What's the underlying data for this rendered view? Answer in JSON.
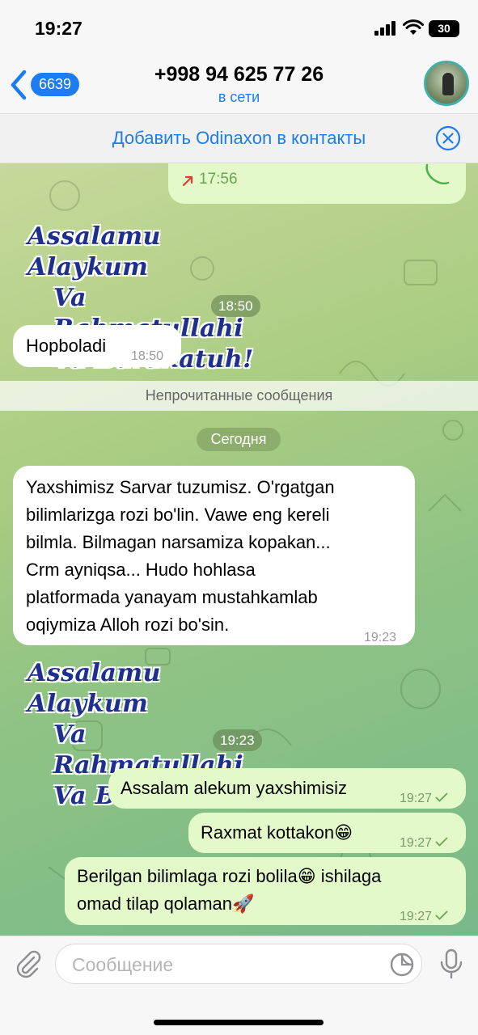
{
  "status_bar": {
    "time": "19:27",
    "battery": "30"
  },
  "nav": {
    "back_count": "6639",
    "title": "+998 94 625 77 26",
    "status": "в сети"
  },
  "banner": {
    "text": "Добавить Odinaxon в контакты"
  },
  "chat": {
    "call_bubble": {
      "time": "17:56"
    },
    "sticker_1": {
      "lines": [
        "Assalamu Alaykum",
        "Va Rahmatullahi",
        "Va Barakatuh!"
      ],
      "time": "18:50"
    },
    "msg_hopboladi": {
      "text": "Hopboladi",
      "time": "18:50"
    },
    "unread_label": "Непрочитанные сообщения",
    "date_label": "Сегодня",
    "msg_long": {
      "lines": [
        "Yaxshimisz Sarvar tuzumisz. O'rgatgan",
        "bilimlarizga rozi bo'lin. Vawe eng kereli",
        "bilmla. Bilmagan narsamiza kopakan...",
        "Crm  ayniqsa... Hudo hohlasa",
        "platformada yanayam mustahkamlab",
        "oqiymiza Alloh rozi bo'sin."
      ],
      "time": "19:23"
    },
    "sticker_2": {
      "lines": [
        "Assalamu Alaykum",
        "Va Rahmatullahi",
        "Va Barakatuh!"
      ],
      "time": "19:23"
    },
    "out_1": {
      "text": "Assalam alekum yaxshimisiz",
      "time": "19:27"
    },
    "out_2": {
      "text": "Raxmat kottakon😁",
      "time": "19:27"
    },
    "out_3": {
      "line1": "Berilgan bilimlaga rozi bolila😁 ishilaga",
      "line2": "omad tilap qolaman🚀",
      "time": "19:27"
    }
  },
  "input": {
    "placeholder": "Сообщение"
  },
  "colors": {
    "accent": "#1d7cf2",
    "outgoing_bubble": "#e3f9c9",
    "incoming_bubble": "#ffffff",
    "missed_arrow": "#e53935"
  },
  "icons": [
    "signal-icon",
    "wifi-icon",
    "back-chevron-icon",
    "close-circle-icon",
    "phone-icon",
    "outgoing-arrow-icon",
    "check-icon",
    "attach-icon",
    "sticker-icon",
    "mic-icon"
  ]
}
